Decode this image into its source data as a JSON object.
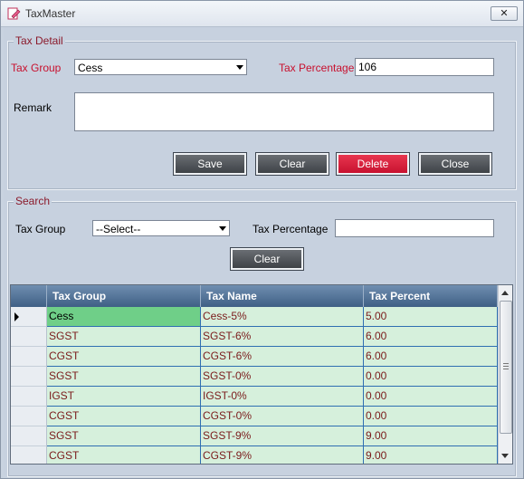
{
  "window": {
    "title": "TaxMaster",
    "close_glyph": "✕",
    "icon": "document-edit-icon"
  },
  "tax_detail": {
    "legend": "Tax Detail",
    "tax_group_label": "Tax Group",
    "tax_group_value": "Cess",
    "tax_percentage_label": "Tax Percentage",
    "tax_percentage_value": "106",
    "remark_label": "Remark",
    "remark_value": "",
    "buttons": {
      "save": "Save",
      "clear": "Clear",
      "delete": "Delete",
      "close": "Close"
    }
  },
  "search": {
    "legend": "Search",
    "tax_group_label": "Tax Group",
    "tax_group_value": "--Select--",
    "tax_percentage_label": "Tax Percentage",
    "tax_percentage_value": "",
    "clear_button": "Clear"
  },
  "grid": {
    "columns": [
      "Tax Group",
      "Tax Name",
      "Tax Percent"
    ],
    "rows": [
      [
        "Cess",
        "Cess-5%",
        "5.00"
      ],
      [
        "SGST",
        "SGST-6%",
        "6.00"
      ],
      [
        "CGST",
        "CGST-6%",
        "6.00"
      ],
      [
        "SGST",
        "SGST-0%",
        "0.00"
      ],
      [
        "IGST",
        "IGST-0%",
        "0.00"
      ],
      [
        "CGST",
        "CGST-0%",
        "0.00"
      ],
      [
        "SGST",
        "SGST-9%",
        "9.00"
      ],
      [
        "CGST",
        "CGST-9%",
        "9.00"
      ]
    ],
    "selected_row": 0
  },
  "colors": {
    "label_red": "#c8102e",
    "legend": "#8b1a2b",
    "delete": "#c81230",
    "row_bg": "#d6f0dc",
    "selected_bg": "#6fcf88"
  }
}
